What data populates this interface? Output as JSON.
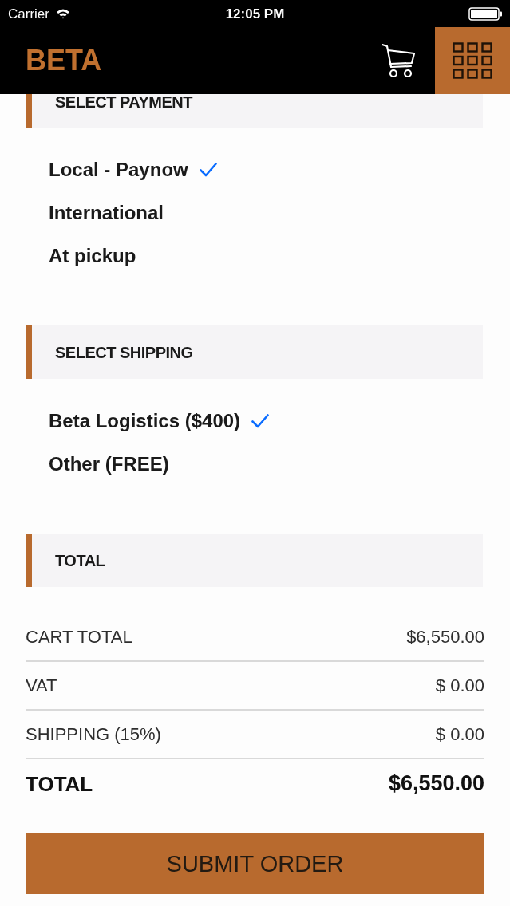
{
  "status_bar": {
    "carrier": "Carrier",
    "time": "12:05 PM"
  },
  "header": {
    "logo": "BETA"
  },
  "sections": [
    {
      "title": "SELECT PAYMENT",
      "options": [
        {
          "label": "Local - Paynow",
          "selected": true
        },
        {
          "label": "International",
          "selected": false
        },
        {
          "label": "At pickup",
          "selected": false
        }
      ]
    },
    {
      "title": "SELECT SHIPPING",
      "options": [
        {
          "label": "Beta Logistics ($400)",
          "selected": true
        },
        {
          "label": "Other (FREE)",
          "selected": false
        }
      ]
    },
    {
      "title": "TOTAL",
      "rows": [
        {
          "kind": "line",
          "label": "CART TOTAL",
          "value": "$6,550.00"
        },
        {
          "kind": "line",
          "label": "VAT",
          "value": "$ 0.00"
        },
        {
          "kind": "line",
          "label": "SHIPPING (15%)",
          "value": "$ 0.00"
        },
        {
          "kind": "grand",
          "label": "TOTAL",
          "value": "$6,550.00"
        }
      ]
    }
  ],
  "submit_button": "SUBMIT ORDER"
}
